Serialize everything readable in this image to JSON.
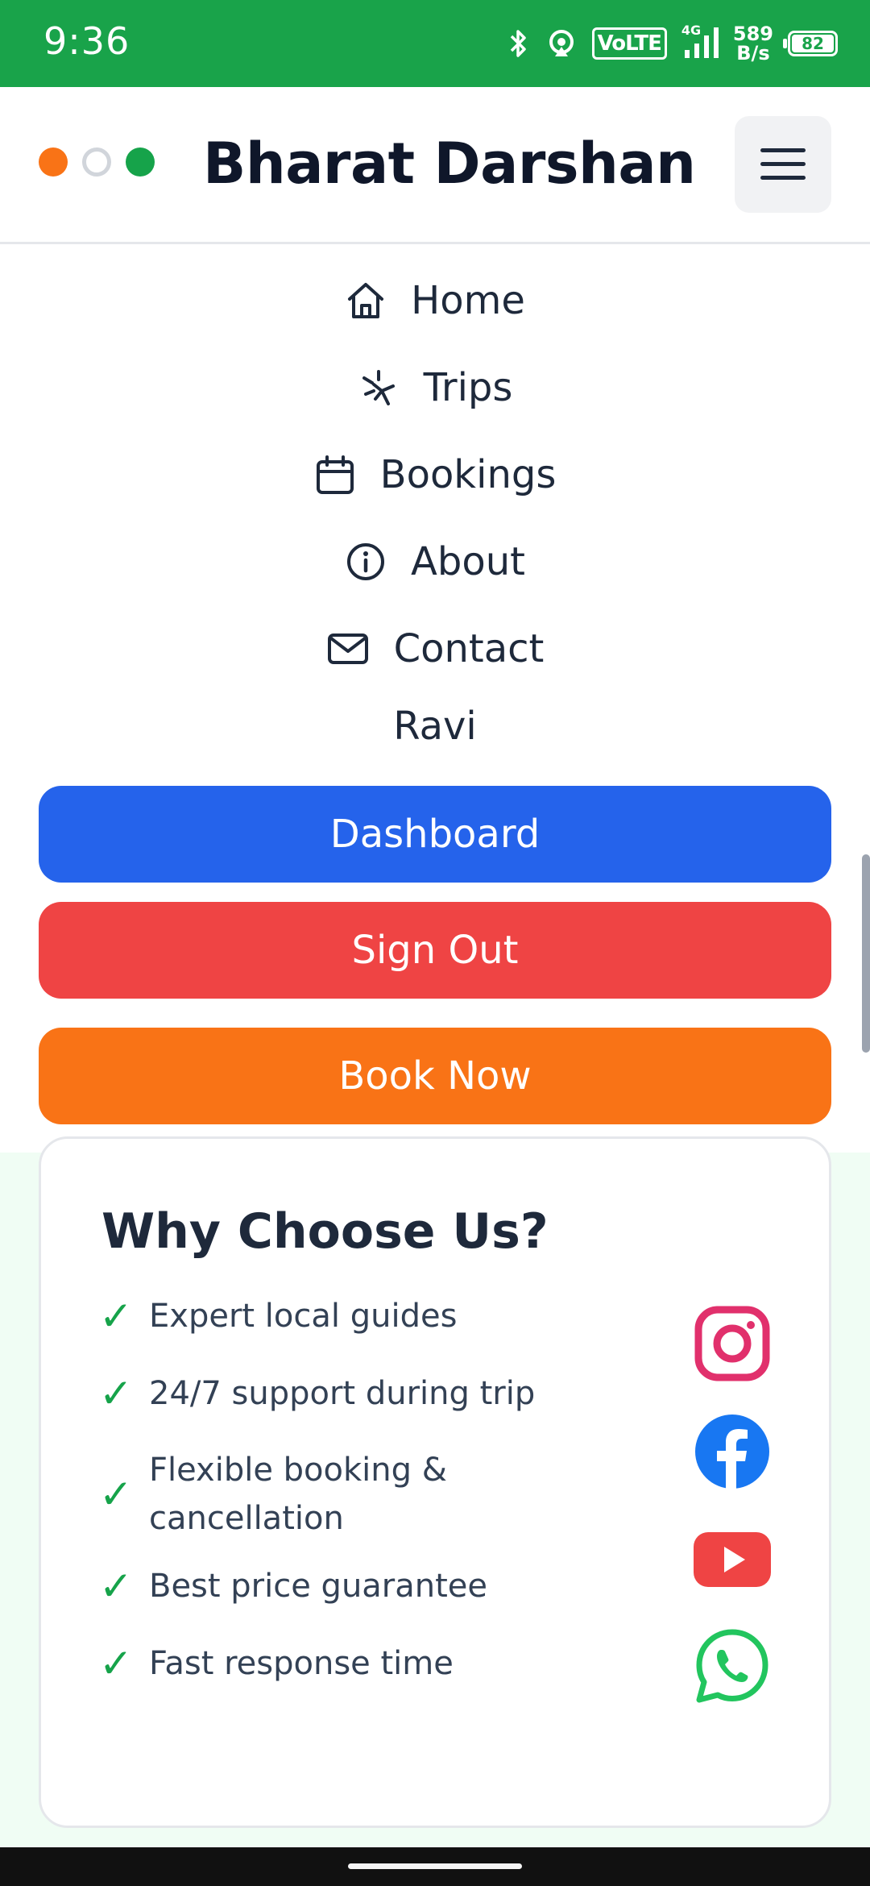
{
  "status_bar": {
    "time": "9:36",
    "network_label": "VoLTE",
    "network_gen": "4G",
    "speed_value": "589",
    "speed_unit": "B/s",
    "battery": "82"
  },
  "header": {
    "brand": "Bharat Darshan",
    "dot_colors": [
      "#f97316",
      "#d1d5db",
      "#16a34a"
    ]
  },
  "menu": {
    "items": [
      {
        "label": "Home",
        "icon": "home-icon"
      },
      {
        "label": "Trips",
        "icon": "trips-icon"
      },
      {
        "label": "Bookings",
        "icon": "calendar-icon"
      },
      {
        "label": "About",
        "icon": "info-icon"
      },
      {
        "label": "Contact",
        "icon": "mail-icon"
      }
    ],
    "user": "Ravi",
    "dashboard_label": "Dashboard",
    "signout_label": "Sign Out",
    "book_label": "Book Now"
  },
  "why": {
    "title": "Why Choose Us?",
    "features": [
      "Expert local guides",
      "24/7 support during trip",
      "Flexible booking & cancellation",
      "Best price guarantee",
      "Fast response time"
    ],
    "social": [
      "instagram-icon",
      "facebook-icon",
      "youtube-icon",
      "whatsapp-icon"
    ]
  },
  "colors": {
    "status_green": "#19a34a",
    "primary_blue": "#2563eb",
    "danger_red": "#ef4444",
    "accent_orange": "#f97316",
    "check_green": "#16a34a"
  }
}
